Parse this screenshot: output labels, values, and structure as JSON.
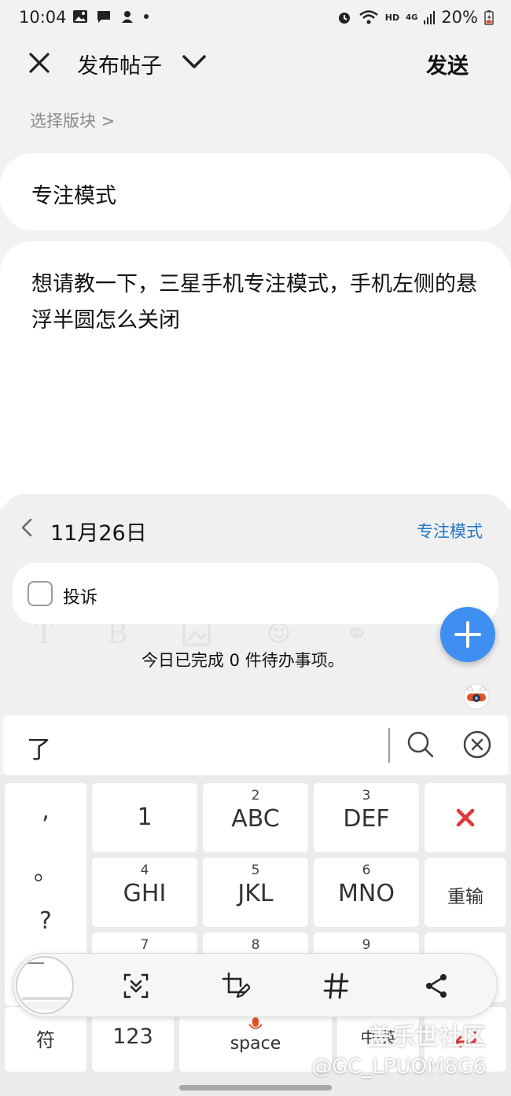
{
  "status": {
    "time": "10:04",
    "hd": "HD",
    "network": "4G",
    "battery": "20%"
  },
  "header": {
    "title": "发布帖子",
    "send_label": "发送"
  },
  "board_selector": "选择版块 >",
  "post": {
    "title": "专注模式",
    "body": "想请教一下，三星手机专注模式，手机左侧的悬浮半圆怎么关闭"
  },
  "todo": {
    "date": "11月26日",
    "mode_link": "专注模式",
    "items": [
      {
        "label": "投诉",
        "checked": false
      }
    ],
    "summary": "今日已完成 0 件待办事项。",
    "ghost_glyphs": [
      "T",
      "B",
      "",
      "☺",
      "⚭"
    ]
  },
  "ime": {
    "candidate": "了"
  },
  "keyboard": {
    "punct": [
      ",",
      "。",
      "?"
    ],
    "rows": [
      [
        {
          "sub": "",
          "main": "1"
        },
        {
          "sub": "2",
          "main": "ABC"
        },
        {
          "sub": "3",
          "main": "DEF"
        }
      ],
      [
        {
          "sub": "4",
          "main": "GHI"
        },
        {
          "sub": "5",
          "main": "JKL"
        },
        {
          "sub": "6",
          "main": "MNO"
        }
      ],
      [
        {
          "sub": "7",
          "main": ""
        },
        {
          "sub": "8",
          "main": ""
        },
        {
          "sub": "9",
          "main": ""
        }
      ]
    ],
    "retype": "重输",
    "bottom": {
      "symbols": "符",
      "numbers": "123",
      "space": "space",
      "lang": "中/英"
    }
  },
  "watermark": {
    "line1": "盖乐世社区",
    "line2": "@GC_LPUOM8G6"
  },
  "colors": {
    "accent": "#1f78c8",
    "fab": "#3f8ef2",
    "delete": "#e2373a"
  }
}
